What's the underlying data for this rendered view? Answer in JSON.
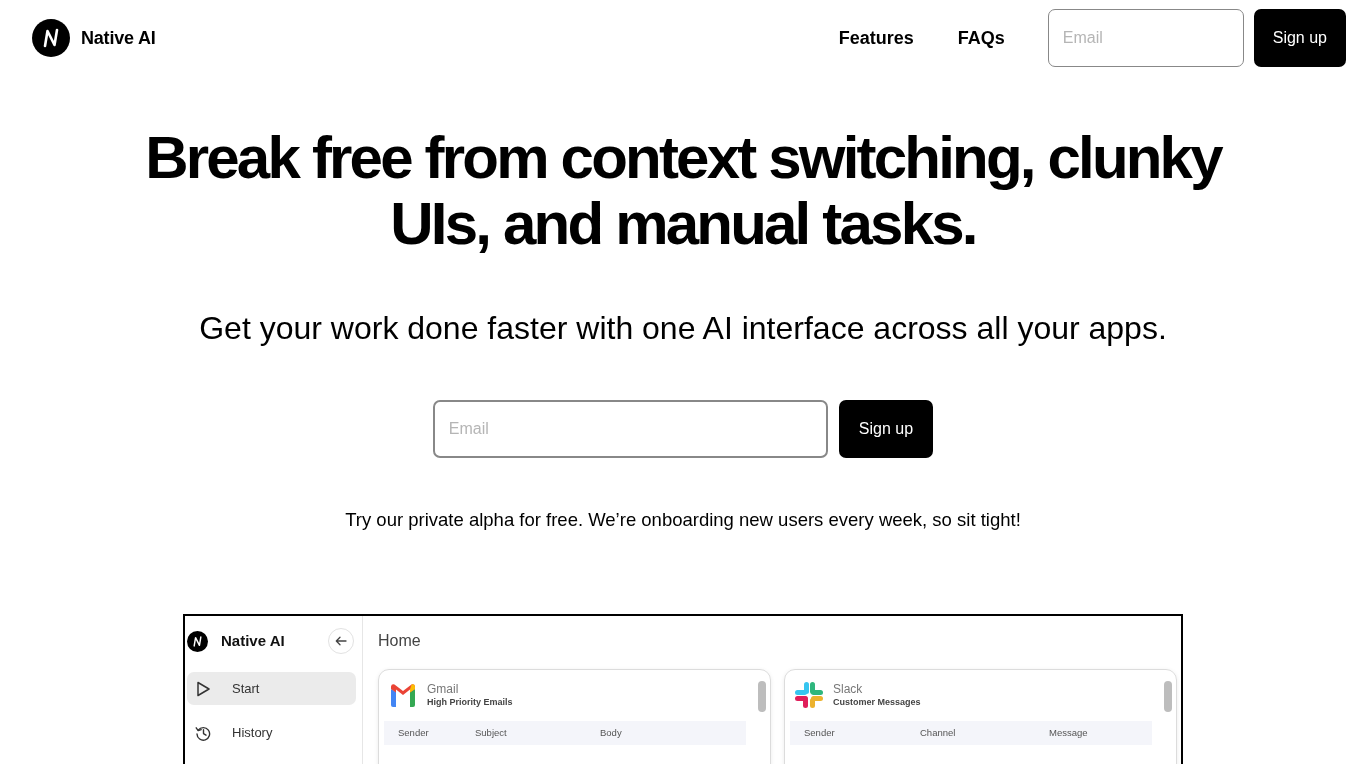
{
  "navbar": {
    "brand": "Native AI",
    "links": [
      {
        "label": "Features"
      },
      {
        "label": "FAQs"
      }
    ],
    "email_field": {
      "placeholder": "Email"
    },
    "signup_button": "Sign up"
  },
  "hero": {
    "headline": "Break free from context switching, clunky UIs, and manual tasks.",
    "subheadline": "Get your work done faster with one AI interface across all your apps.",
    "email_field": {
      "placeholder": "Email"
    },
    "signup_button": "Sign up",
    "note": "Try our private alpha for free. We’re onboarding new users every week, so sit tight!"
  },
  "app_preview": {
    "sidebar": {
      "brand": "Native AI",
      "items": [
        {
          "kind": "start",
          "label": "Start",
          "selected": true
        },
        {
          "kind": "history",
          "label": "History",
          "selected": false
        }
      ]
    },
    "page_title": "Home",
    "cards": [
      {
        "kind": "gmail",
        "title": "Gmail",
        "subtitle": "High Priority Emails",
        "columns": [
          "Sender",
          "Subject",
          "Body"
        ]
      },
      {
        "kind": "slack",
        "title": "Slack",
        "subtitle": "Customer Messages",
        "columns": [
          "Sender",
          "Channel",
          "Message"
        ]
      }
    ]
  }
}
